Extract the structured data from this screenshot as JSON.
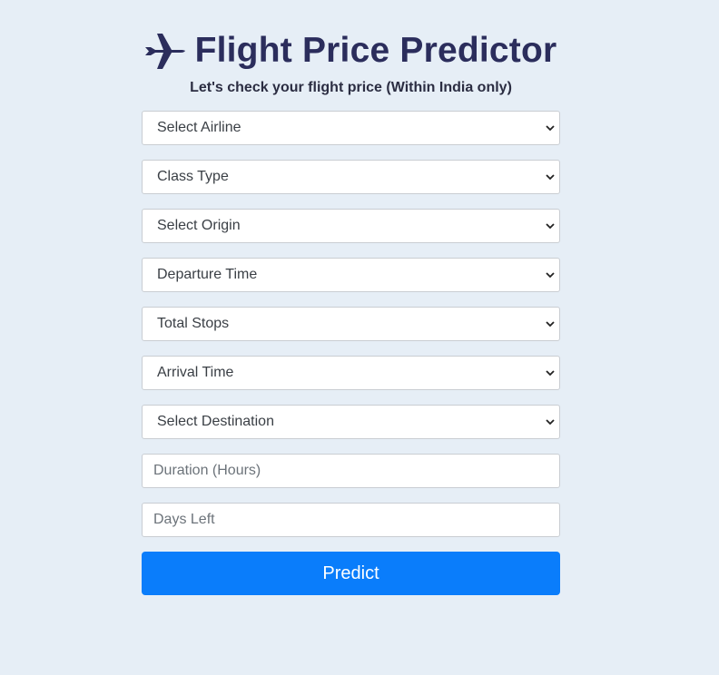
{
  "header": {
    "icon": "airplane-icon",
    "title": "Flight Price Predictor",
    "subtitle": "Let's check your flight price (Within India only)"
  },
  "form": {
    "selects": [
      {
        "label": "Select Airline"
      },
      {
        "label": "Class Type"
      },
      {
        "label": "Select Origin"
      },
      {
        "label": "Departure Time"
      },
      {
        "label": "Total Stops"
      },
      {
        "label": "Arrival Time"
      },
      {
        "label": "Select Destination"
      }
    ],
    "inputs": [
      {
        "placeholder": "Duration (Hours)"
      },
      {
        "placeholder": "Days Left"
      }
    ],
    "submit_label": "Predict"
  },
  "colors": {
    "background": "#e6eef6",
    "title": "#2b2d5c",
    "button": "#0a7dfb"
  }
}
